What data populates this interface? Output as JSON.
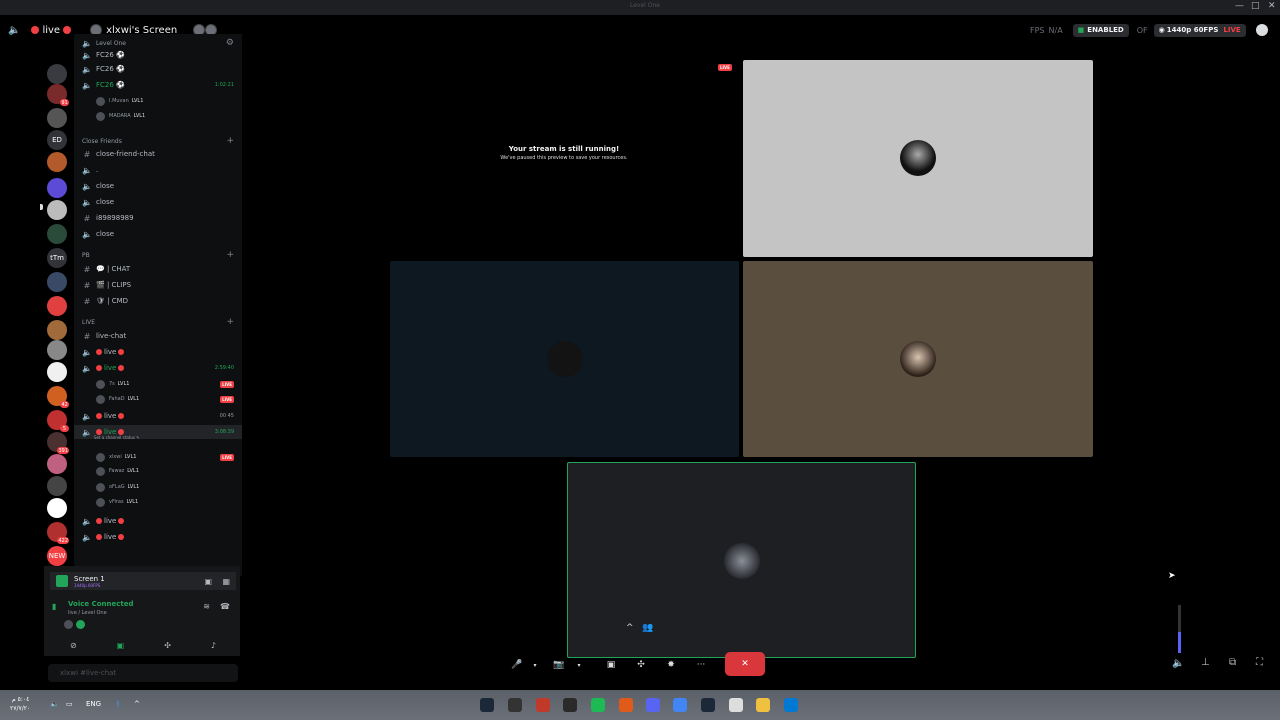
{
  "window": {
    "controls": [
      "—",
      "□",
      "✕"
    ],
    "center_hint": "Level One"
  },
  "header": {
    "live_label": "live",
    "screen_title": "xlxwi's Screen",
    "fps_label": "FPS",
    "fps_value": "N/A",
    "enabled_label": "ENABLED",
    "quality_label": "1440p 60FPS",
    "live_badge": "LIVE",
    "extra": "OF"
  },
  "rail": {
    "items": [
      {
        "label": "",
        "badge": "",
        "color": "#3a3b40"
      },
      {
        "label": "",
        "badge": "91",
        "color": "#7a2a2a"
      },
      {
        "label": "",
        "badge": "",
        "color": "#555"
      },
      {
        "label": "ED",
        "badge": "",
        "color": "#313338"
      },
      {
        "label": "",
        "badge": "",
        "color": "#b35a2a"
      },
      {
        "label": "",
        "badge": "",
        "color": "#5b4bd6"
      },
      {
        "label": "",
        "badge": "",
        "color": "#bbbbbb"
      },
      {
        "label": "",
        "badge": "",
        "color": "#2a4a3a"
      },
      {
        "label": "tTm",
        "badge": "",
        "color": "#313338"
      },
      {
        "label": "",
        "badge": "",
        "color": "#3a4a66"
      },
      {
        "label": "",
        "badge": "",
        "color": "#e04040"
      },
      {
        "label": "",
        "badge": "",
        "color": "#a06a3a"
      },
      {
        "label": "",
        "badge": "",
        "color": "#888888"
      },
      {
        "label": "",
        "badge": "",
        "color": "#f0f0f0"
      },
      {
        "label": "",
        "badge": "42",
        "color": "#d06020"
      },
      {
        "label": "",
        "badge": "5",
        "color": "#c03030"
      },
      {
        "label": "",
        "badge": "391",
        "color": "#4a3030"
      },
      {
        "label": "",
        "badge": "",
        "color": "#c06080"
      },
      {
        "label": "",
        "badge": "",
        "color": "#444444"
      },
      {
        "label": "",
        "badge": "",
        "color": "#ffffff"
      },
      {
        "label": "",
        "badge": "422",
        "color": "#b03030"
      },
      {
        "label": "NEW",
        "badge": "",
        "color": "#f23f43"
      }
    ]
  },
  "sidebar": {
    "server_hint": "Level One",
    "channels": [
      {
        "type": "voice",
        "name": "FC26 ⚽",
        "extra": ""
      },
      {
        "type": "voice",
        "name": "FC26 ⚽",
        "extra": ""
      },
      {
        "type": "voice-active",
        "name": "FC26 ⚽",
        "time": "1:02:21"
      },
      {
        "type": "user",
        "name": "I.Muvan",
        "lvl": "LVL1",
        "live": ""
      },
      {
        "type": "user",
        "name": "MADARA",
        "lvl": "LVL1",
        "live": ""
      },
      {
        "type": "category",
        "name": "Close Friends"
      },
      {
        "type": "text",
        "name": "close-friend-chat"
      },
      {
        "type": "voice",
        "name": "."
      },
      {
        "type": "voice",
        "name": "close"
      },
      {
        "type": "voice",
        "name": "close"
      },
      {
        "type": "text",
        "name": "i89898989"
      },
      {
        "type": "voice",
        "name": "close"
      },
      {
        "type": "category",
        "name": "PB"
      },
      {
        "type": "text",
        "name": "💬 | CHAT"
      },
      {
        "type": "text",
        "name": "🎬 | CLIPS"
      },
      {
        "type": "text",
        "name": "🛡 | CMD"
      },
      {
        "type": "category",
        "name": "LIVE"
      },
      {
        "type": "text",
        "name": "live-chat"
      },
      {
        "type": "voice",
        "name": "live"
      },
      {
        "type": "voice-active",
        "name": "live",
        "time": "2:59:40"
      },
      {
        "type": "user",
        "name": "7s",
        "lvl": "LVL1",
        "live": "LIVE"
      },
      {
        "type": "user",
        "name": "FahaD",
        "lvl": "LVL1",
        "live": "LIVE"
      },
      {
        "type": "voice",
        "name": "live",
        "time": "00  45"
      },
      {
        "type": "voice-active",
        "name": "live",
        "time": "3:08:39",
        "status": "Set a channel status ✎"
      },
      {
        "type": "user",
        "name": "xlxwi",
        "lvl": "LVL1",
        "live": "LIVE"
      },
      {
        "type": "user",
        "name": "Fawaz",
        "lvl": "LVL1",
        "live": ""
      },
      {
        "type": "user",
        "name": "oFLaG",
        "lvl": "LVL1",
        "live": ""
      },
      {
        "type": "user",
        "name": "vFiras",
        "lvl": "LVL1",
        "live": ""
      },
      {
        "type": "voice",
        "name": "live"
      },
      {
        "type": "voice",
        "name": "live"
      }
    ]
  },
  "panel": {
    "screen_label": "Screen 1",
    "screen_sub": "1440p 60FPS",
    "voice_status": "Voice Connected",
    "voice_channel": "live / Level One",
    "message_placeholder": "xlxwi   #live-chat"
  },
  "stream": {
    "paused_title": "Your stream is still running!",
    "paused_sub": "We've paused this preview to save your resources.",
    "live_badge": "LIVE"
  },
  "controls": {
    "mic": "🎤",
    "camera": "📷",
    "more": "···"
  },
  "taskbar": {
    "time": "٥:٠٤ م",
    "date": "٢٧/٧/٢٠",
    "lang": "ENG",
    "app_colors": [
      "#1b2838",
      "#333333",
      "#c0392b",
      "#2a2a2a",
      "#1db954",
      "#e05a1a",
      "#5865f2",
      "#4285f4",
      "#1b2838",
      "#dddddd",
      "#f0c040",
      "#0078d4"
    ]
  }
}
